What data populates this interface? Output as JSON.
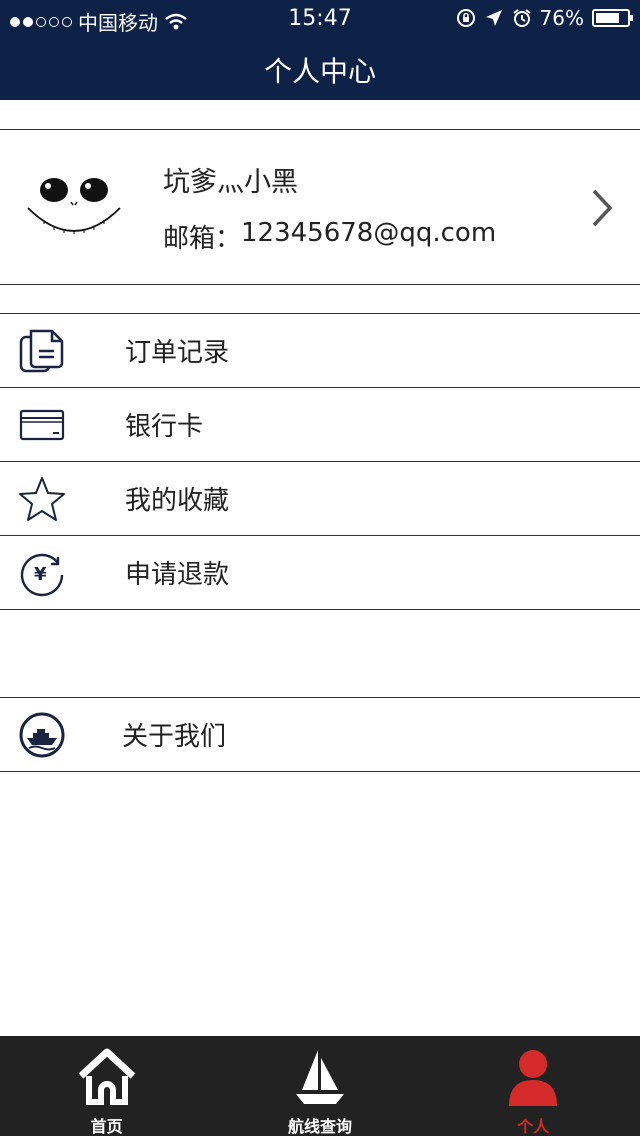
{
  "status_bar": {
    "carrier": "中国移动",
    "time": "15:47",
    "battery": "76%",
    "battery_level": 0.76
  },
  "nav": {
    "title": "个人中心"
  },
  "profile": {
    "username": "坑爹灬小黑",
    "email_label": "邮箱：",
    "email": "12345678@qq.com"
  },
  "menu": {
    "items": [
      {
        "label": "订单记录",
        "icon": "orders-icon"
      },
      {
        "label": "银行卡",
        "icon": "bank-card-icon"
      },
      {
        "label": "我的收藏",
        "icon": "star-icon"
      },
      {
        "label": "申请退款",
        "icon": "refund-icon"
      }
    ],
    "about": {
      "label": "关于我们",
      "icon": "ship-icon"
    }
  },
  "tabbar": {
    "tabs": [
      {
        "label": "首页",
        "icon": "home-icon"
      },
      {
        "label": "航线查询",
        "icon": "sailboat-icon"
      },
      {
        "label": "个人",
        "icon": "person-icon"
      }
    ],
    "active_color": "#d42a2a"
  },
  "colors": {
    "header_bg": "#0e2248",
    "tabbar_bg": "#222222"
  }
}
